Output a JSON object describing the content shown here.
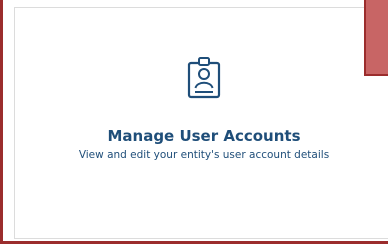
{
  "card": {
    "icon": "user-badge-icon",
    "title": "Manage User Accounts",
    "description": "View and edit your entity's user account details"
  },
  "colors": {
    "accent_red": "#9b2d2d",
    "flag_fill": "#c86565",
    "text_blue": "#1f4e79",
    "card_border": "#dcdcdc"
  }
}
